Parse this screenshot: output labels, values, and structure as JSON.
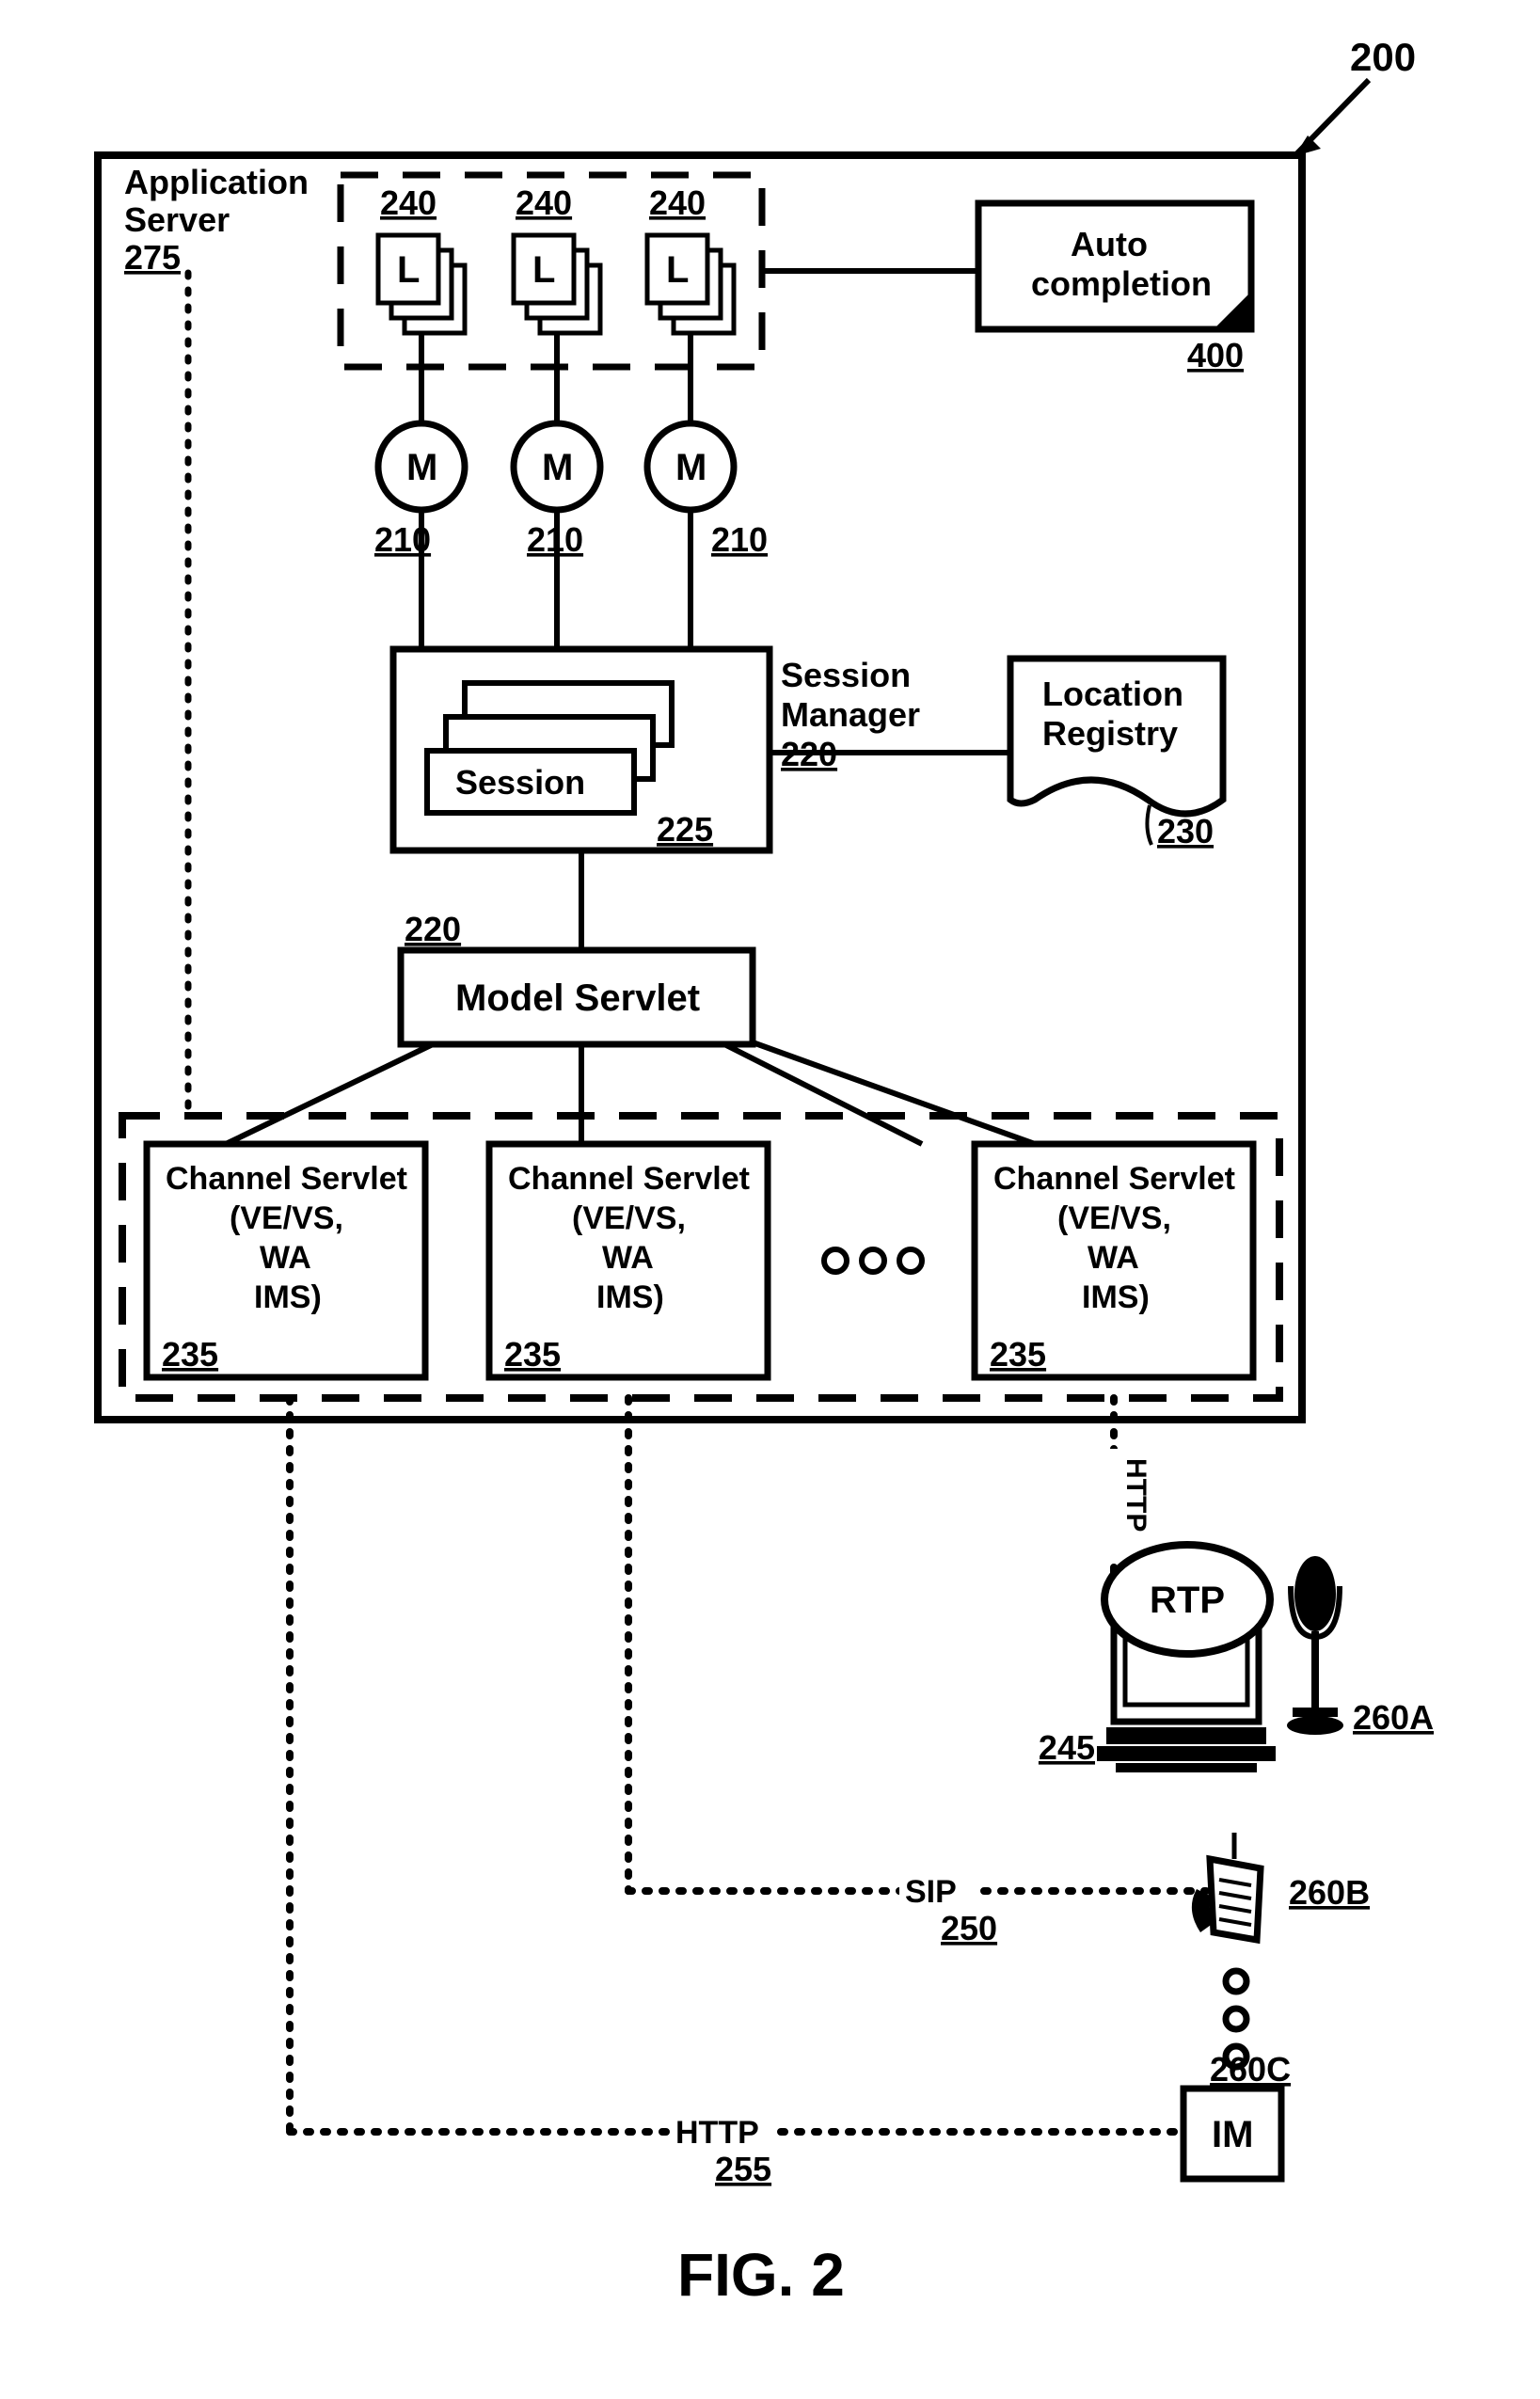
{
  "fig": "FIG. 2",
  "ref_system": "200",
  "application_server": {
    "title_l1": "Application",
    "title_l2": "Server",
    "ref": "275"
  },
  "listeners": {
    "label": "L",
    "ref": "240"
  },
  "auto_completion": {
    "l1": "Auto",
    "l2": "completion",
    "ref": "400"
  },
  "model_circles": {
    "label": "M",
    "ref": "210"
  },
  "session_manager": {
    "title_l1": "Session",
    "title_l2": "Manager",
    "ref": "220",
    "session_label": "Session",
    "session_ref": "225"
  },
  "location_registry": {
    "l1": "Location",
    "l2": "Registry",
    "ref": "230"
  },
  "ref_above_model": "220",
  "model_servlet": "Model Servlet",
  "channel_servlet": {
    "l1": "Channel Servlet",
    "l2": "(VE/VS,",
    "l3": "WA",
    "l4": "IMS)",
    "ref": "235"
  },
  "rtp": "RTP",
  "http": "HTTP",
  "sip": "SIP",
  "ref_245": "245",
  "ref_250": "250",
  "ref_255": "255",
  "ref_260A": "260A",
  "ref_260B": "260B",
  "ref_260C": "260C",
  "im": "IM"
}
